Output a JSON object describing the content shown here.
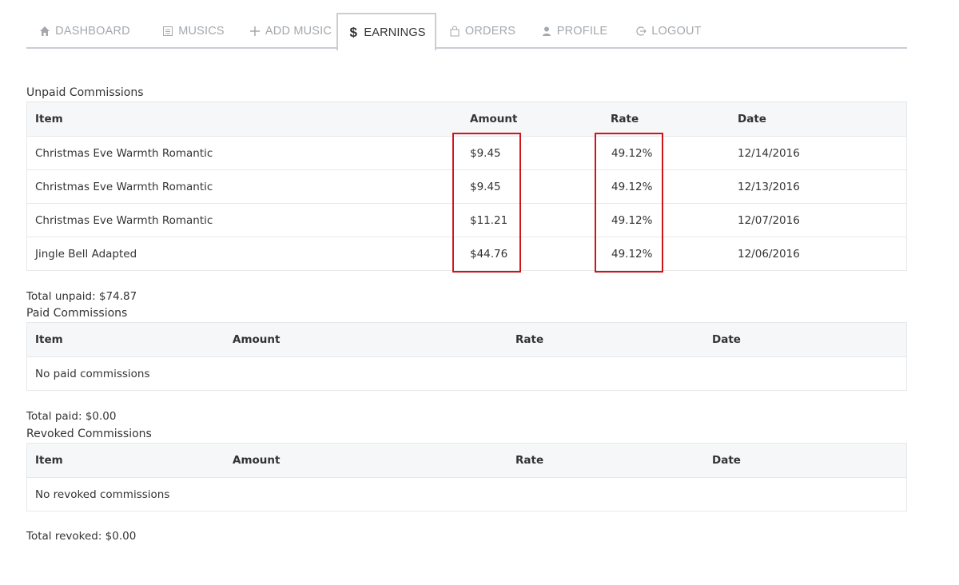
{
  "nav": {
    "tabs": [
      {
        "label": "DASHBOARD",
        "icon": "home-icon"
      },
      {
        "label": "MUSICS",
        "icon": "list-icon"
      },
      {
        "label": "ADD MUSIC",
        "icon": "plus-icon"
      },
      {
        "label": "EARNINGS",
        "icon": "dollar-icon",
        "active": true
      },
      {
        "label": "ORDERS",
        "icon": "bag-icon"
      },
      {
        "label": "PROFILE",
        "icon": "user-icon"
      },
      {
        "label": "LOGOUT",
        "icon": "logout-icon"
      }
    ]
  },
  "unpaid": {
    "title": "Unpaid Commissions",
    "headers": [
      "Item",
      "Amount",
      "Rate",
      "Date"
    ],
    "rows": [
      {
        "item": "Christmas Eve Warmth Romantic",
        "amount": "$9.45",
        "rate": "49.12%",
        "date": "12/14/2016"
      },
      {
        "item": "Christmas Eve Warmth Romantic",
        "amount": "$9.45",
        "rate": "49.12%",
        "date": "12/13/2016"
      },
      {
        "item": "Christmas Eve Warmth Romantic",
        "amount": "$11.21",
        "rate": "49.12%",
        "date": "12/07/2016"
      },
      {
        "item": "Jingle Bell Adapted",
        "amount": "$44.76",
        "rate": "49.12%",
        "date": "12/06/2016"
      }
    ],
    "total": "Total unpaid: $74.87"
  },
  "paid": {
    "title": "Paid Commissions",
    "headers": [
      "Item",
      "Amount",
      "Rate",
      "Date"
    ],
    "empty": "No paid commissions",
    "total": "Total paid: $0.00"
  },
  "revoked": {
    "title": "Revoked Commissions",
    "headers": [
      "Item",
      "Amount",
      "Rate",
      "Date"
    ],
    "empty": "No revoked commissions",
    "total": "Total revoked: $0.00"
  },
  "colors": {
    "highlight": "#d0141a",
    "tab_inactive": "#a3a8ad",
    "border": "#c9ced3"
  }
}
